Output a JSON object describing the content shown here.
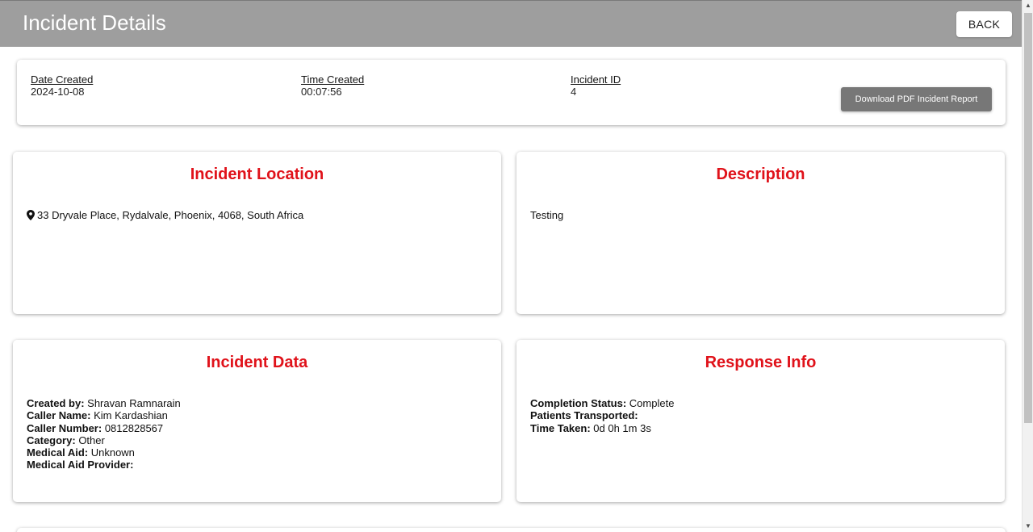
{
  "header": {
    "title": "Incident Details",
    "back_label": "BACK"
  },
  "summary": {
    "date_label": "Date Created",
    "date_value": "2024-10-08",
    "time_label": "Time Created",
    "time_value": "00:07:56",
    "id_label": "Incident ID",
    "id_value": "4",
    "pdf_button": "Download PDF Incident Report"
  },
  "location": {
    "title": "Incident Location",
    "icon": "map-marker-icon",
    "address": "33 Dryvale Place, Rydalvale, Phoenix, 4068, South Africa"
  },
  "description": {
    "title": "Description",
    "text": "Testing"
  },
  "incident_data": {
    "title": "Incident Data",
    "fields": [
      {
        "label": "Created by:",
        "value": "Shravan Ramnarain"
      },
      {
        "label": "Caller Name:",
        "value": "Kim Kardashian"
      },
      {
        "label": "Caller Number:",
        "value": "0812828567"
      },
      {
        "label": "Category:",
        "value": "Other"
      },
      {
        "label": "Medical Aid:",
        "value": "Unknown"
      },
      {
        "label": "Medical Aid Provider:",
        "value": ""
      }
    ]
  },
  "response_info": {
    "title": "Response Info",
    "fields": [
      {
        "label": "Completion Status:",
        "value": "Complete"
      },
      {
        "label": "Patients Transported:",
        "value": ""
      },
      {
        "label": "Time Taken:",
        "value": "0d 0h 1m 3s"
      }
    ]
  },
  "colors": {
    "header_bg": "#9e9e9e",
    "accent_red": "#e0121a",
    "pdf_button_bg": "#777777"
  }
}
